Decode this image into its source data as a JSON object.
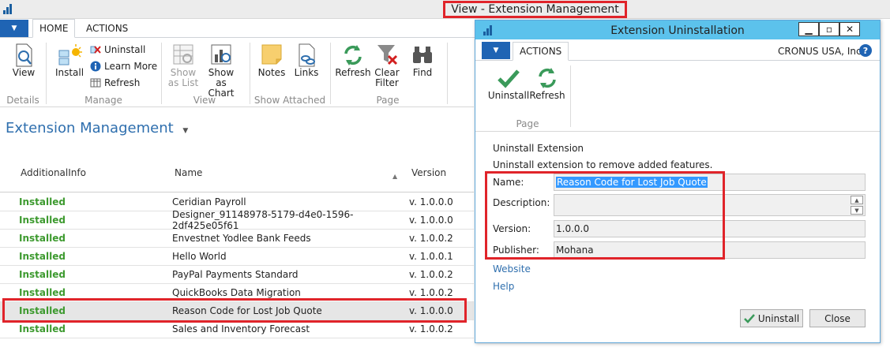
{
  "main": {
    "window_title": "View - Extension Management",
    "tabs": [
      {
        "label": "HOME"
      },
      {
        "label": "ACTIONS"
      }
    ],
    "ribbon": {
      "view": "View",
      "install": "Install",
      "uninstall": "Uninstall",
      "learn_more": "Learn More",
      "refresh_small": "Refresh",
      "show_as_list": "Show as List",
      "show_as_list_l1": "Show",
      "show_as_list_l2": "as List",
      "show_as_chart_l1": "Show as",
      "show_as_chart_l2": "Chart",
      "notes": "Notes",
      "links": "Links",
      "refresh": "Refresh",
      "clear_filter_l1": "Clear",
      "clear_filter_l2": "Filter",
      "find": "Find",
      "groups": {
        "details": "Details",
        "manage": "Manage",
        "view": "View",
        "show_attached": "Show Attached",
        "page": "Page"
      }
    },
    "page_title": "Extension Management",
    "columns": {
      "c1": "AdditionalInfo",
      "c2": "Name",
      "c3": "Version"
    },
    "rows": [
      {
        "info": "Installed",
        "name": "Ceridian Payroll",
        "version": "v. 1.0.0.0"
      },
      {
        "info": "Installed",
        "name": "Designer_91148978-5179-d4e0-1596-2df425e05f61",
        "version": "v. 1.0.0.0"
      },
      {
        "info": "Installed",
        "name": "Envestnet Yodlee Bank Feeds",
        "version": "v. 1.0.0.2"
      },
      {
        "info": "Installed",
        "name": "Hello World",
        "version": "v. 1.0.0.1"
      },
      {
        "info": "Installed",
        "name": "PayPal Payments Standard",
        "version": "v. 1.0.0.2"
      },
      {
        "info": "Installed",
        "name": "QuickBooks Data Migration",
        "version": "v. 1.0.0.2"
      },
      {
        "info": "Installed",
        "name": "Reason Code for Lost Job Quote",
        "version": "v. 1.0.0.0"
      },
      {
        "info": "Installed",
        "name": "Sales and Inventory Forecast",
        "version": "v. 1.0.0.2"
      }
    ]
  },
  "dialog": {
    "title": "Extension Uninstallation",
    "tab": "ACTIONS",
    "company": "CRONUS USA, Inc.",
    "uninstall": "Uninstall",
    "refresh": "Refresh",
    "group_page": "Page",
    "heading": "Uninstall Extension",
    "description_text": "Uninstall extension to remove added features.",
    "fields": {
      "name_label": "Name:",
      "name_value": "Reason Code for Lost Job Quote",
      "description_label": "Description:",
      "description_value": "",
      "version_label": "Version:",
      "version_value": "1.0.0.0",
      "publisher_label": "Publisher:",
      "publisher_value": "Mohana"
    },
    "links": {
      "website": "Website",
      "help": "Help"
    },
    "buttons": {
      "uninstall": "Uninstall",
      "close": "Close"
    }
  },
  "colors": {
    "accent": "#1f64b4",
    "installed_green": "#3d9a2f",
    "highlight_red": "#e0242a",
    "dialog_titlebar": "#5cc2ec"
  }
}
